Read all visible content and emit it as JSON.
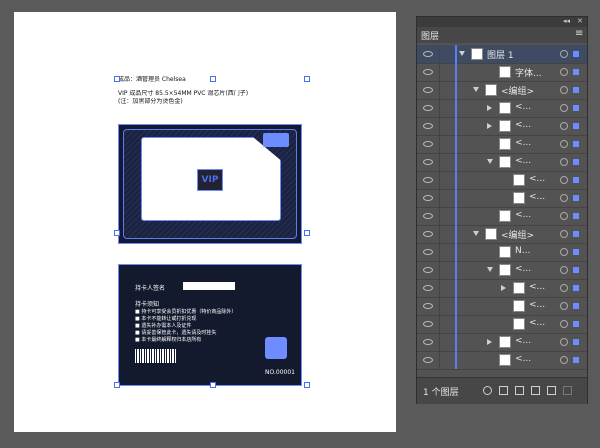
{
  "document": {
    "header_line1": "成品：酒管理员    Chelsea",
    "header_line2": "VIP 成品尺寸 85.5×54MM PVC 滑芯片(西门子)",
    "header_line3": "(注：加黑部分为烫色金)",
    "holder_label": "持卡人签名",
    "notice_title": "持卡须知",
    "notices": [
      "■ 持卡可享受会员折扣优惠（特价商品除外）",
      "■ 本卡不能转让或打折兑现",
      "■ 遗失补办需本人及证件",
      "■ 请妥善保管此卡，遗失请及时挂失",
      "■ 本卡最终解释权归本店所有"
    ],
    "card_number": "NO.00001",
    "vip_mark": "VIP"
  },
  "layers_panel": {
    "tab_title": "图层",
    "collapse_glyph": "◂◂",
    "close_glyph": "✕",
    "menu_glyph": "≡",
    "layers": [
      {
        "name": "图层 1",
        "indent": 0,
        "expand": "down"
      },
      {
        "name": "字体...",
        "indent": 2,
        "expand": ""
      },
      {
        "name": "<编组>",
        "indent": 1,
        "expand": "down"
      },
      {
        "name": "<...",
        "indent": 2,
        "expand": "right"
      },
      {
        "name": "<...",
        "indent": 2,
        "expand": "right"
      },
      {
        "name": "<...",
        "indent": 2,
        "expand": ""
      },
      {
        "name": "<...",
        "indent": 2,
        "expand": "down"
      },
      {
        "name": "<...",
        "indent": 3,
        "expand": ""
      },
      {
        "name": "<...",
        "indent": 3,
        "expand": ""
      },
      {
        "name": "<...",
        "indent": 2,
        "expand": ""
      },
      {
        "name": "<编组>",
        "indent": 1,
        "expand": "down"
      },
      {
        "name": "N...",
        "indent": 2,
        "expand": ""
      },
      {
        "name": "<...",
        "indent": 2,
        "expand": "down"
      },
      {
        "name": "<...",
        "indent": 3,
        "expand": "right"
      },
      {
        "name": "<...",
        "indent": 3,
        "expand": ""
      },
      {
        "name": "<...",
        "indent": 3,
        "expand": ""
      },
      {
        "name": "<...",
        "indent": 2,
        "expand": "right"
      },
      {
        "name": "<...",
        "indent": 2,
        "expand": ""
      }
    ],
    "footer_count": "1 个图层"
  },
  "colors": {
    "canvas_bg": "#5a5a5a",
    "panel_bg": "#535353",
    "selection_blue": "#6d8cff",
    "card_dark": "#141a2e"
  }
}
